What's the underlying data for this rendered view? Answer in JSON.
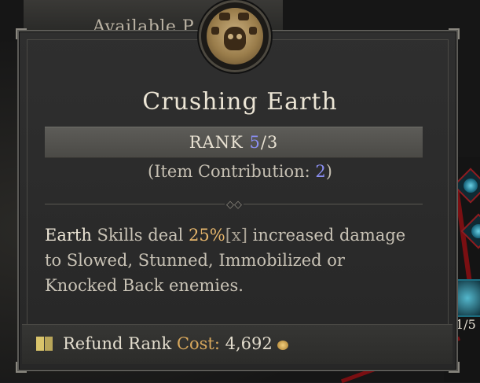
{
  "background": {
    "header_text": "Available P",
    "node_rank_label": "1/5"
  },
  "tooltip": {
    "skill_name": "Crushing Earth",
    "rank": {
      "label": "RANK",
      "current": "5",
      "separator": "/",
      "max": "3"
    },
    "item_contribution": {
      "prefix": "(Item Contribution: ",
      "value": "2",
      "suffix": ")"
    },
    "description": {
      "keyword": "Earth",
      "text_1": " Skills deal ",
      "percent": "25%",
      "multiplier": "[x]",
      "text_2": " increased damage to Slowed, Stunned, Immobilized or Knocked Back enemies."
    },
    "footer": {
      "refund_label": "Refund Rank",
      "cost_label": "Cost:",
      "cost_value": "4,692"
    },
    "icons": {
      "skill": "skull-boulder-icon",
      "refund": "book-icon",
      "gold": "gold-coin-icon"
    }
  },
  "colors": {
    "blue_number": "#8b8ff2",
    "percent_gold": "#e5b56b",
    "cost_gold": "#d7a75c"
  }
}
